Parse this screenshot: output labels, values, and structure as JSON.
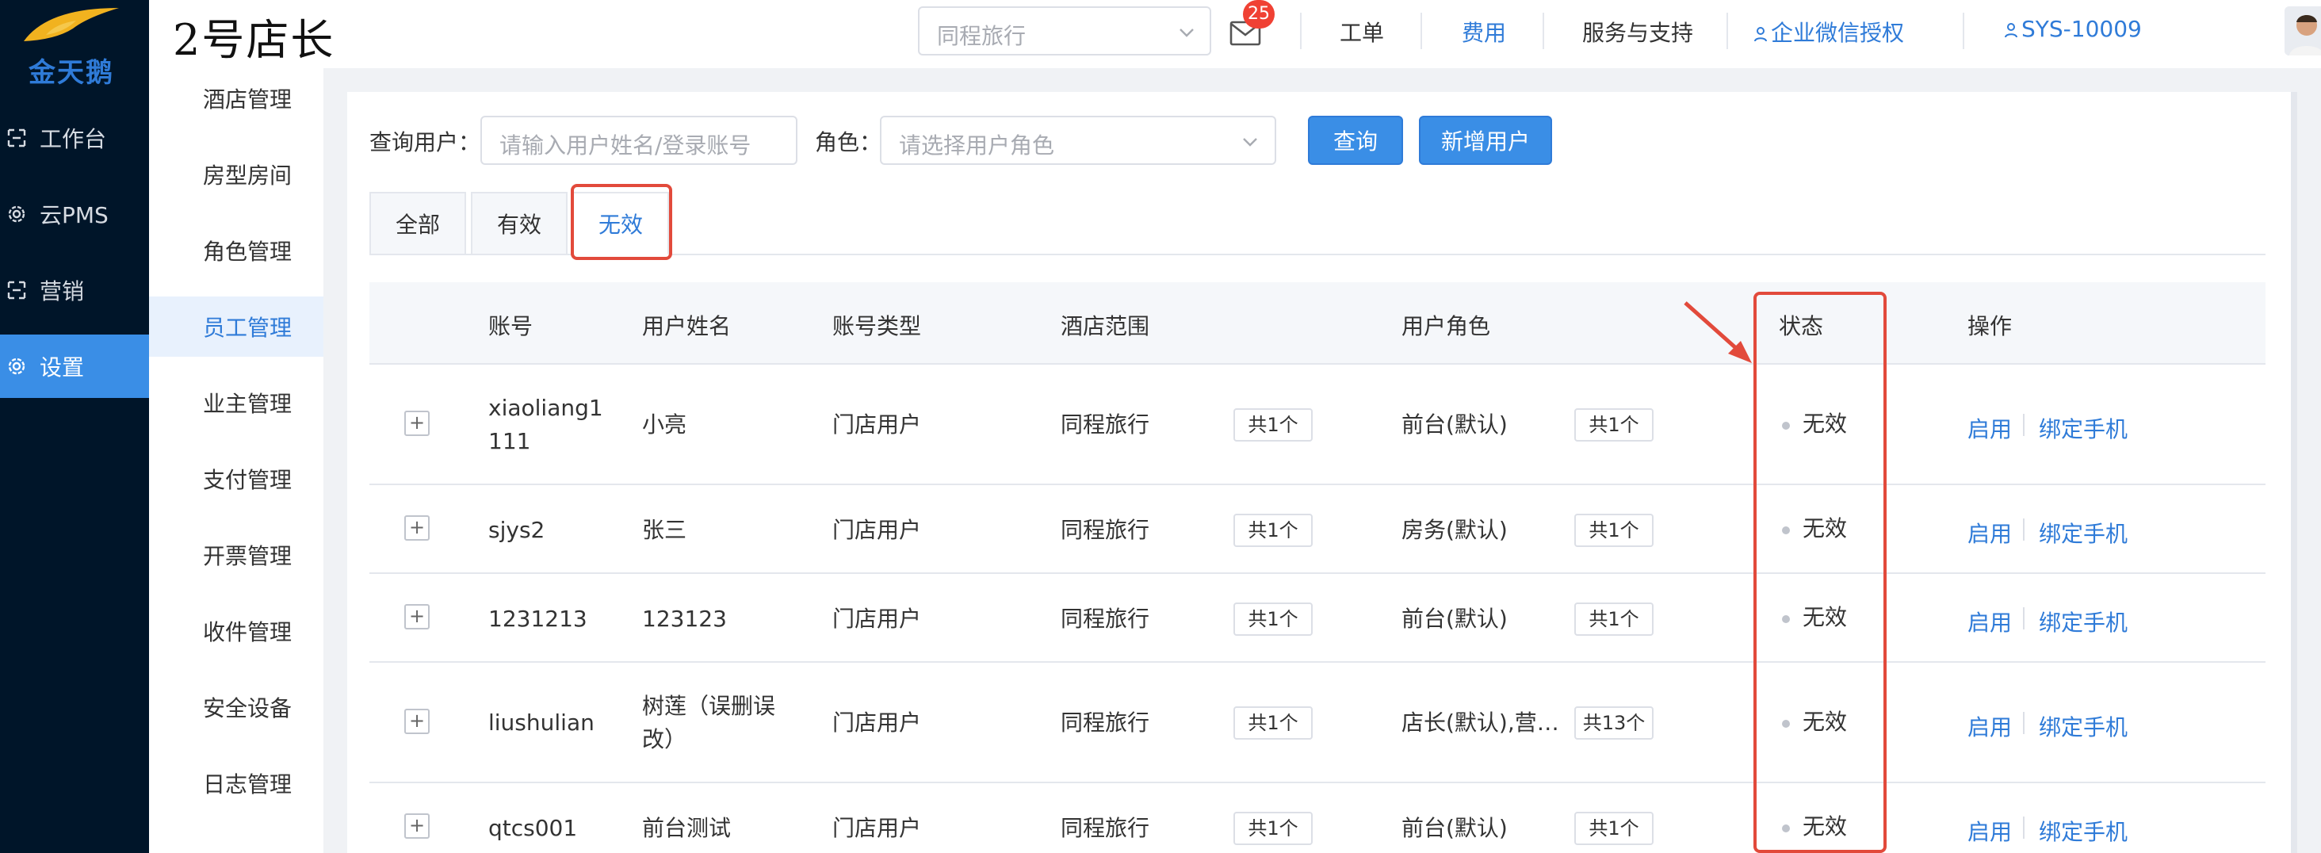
{
  "brand": {
    "logo_text": "金天鹅",
    "app_name": "2号店长"
  },
  "left_nav": {
    "items": [
      {
        "label": "工作台",
        "icon": "workbench-icon"
      },
      {
        "label": "云PMS",
        "icon": "gear-icon"
      },
      {
        "label": "营销",
        "icon": "marketing-icon"
      },
      {
        "label": "设置",
        "icon": "gear-icon",
        "active": true
      }
    ]
  },
  "topbar": {
    "hotel_select": "同程旅行",
    "mail_badge": "25",
    "links": {
      "tickets": "工单",
      "fees": "费用",
      "support": "服务与支持",
      "wechat": "企业微信授权",
      "user": "SYS-10009"
    }
  },
  "sub_menu": {
    "items": [
      "酒店管理",
      "房型房间",
      "角色管理",
      "员工管理",
      "业主管理",
      "支付管理",
      "开票管理",
      "收件管理",
      "安全设备",
      "日志管理"
    ],
    "active": "员工管理"
  },
  "filters": {
    "user_label": "查询用户：",
    "user_placeholder": "请输入用户姓名/登录账号",
    "role_label": "角色：",
    "role_placeholder": "请选择用户角色",
    "query_button": "查询",
    "add_button": "新增用户"
  },
  "tabs": [
    "全部",
    "有效",
    "无效"
  ],
  "active_tab": "无效",
  "table": {
    "headers": {
      "account": "账号",
      "name": "用户姓名",
      "type": "账号类型",
      "scope": "酒店范围",
      "role": "用户角色",
      "status": "状态",
      "actions": "操作"
    },
    "rows": [
      {
        "account": [
          "xiaoliang1",
          "111"
        ],
        "name": [
          "小亮"
        ],
        "type": "门店用户",
        "scope": "同程旅行",
        "scope_count": "共1个",
        "role": "前台(默认)",
        "role_count": "共1个",
        "status": "无效",
        "action_enable": "启用",
        "action_bind": "绑定手机"
      },
      {
        "account": [
          "sjys2"
        ],
        "name": [
          "张三"
        ],
        "type": "门店用户",
        "scope": "同程旅行",
        "scope_count": "共1个",
        "role": "房务(默认)",
        "role_count": "共1个",
        "status": "无效",
        "action_enable": "启用",
        "action_bind": "绑定手机"
      },
      {
        "account": [
          "1231213"
        ],
        "name": [
          "123123"
        ],
        "type": "门店用户",
        "scope": "同程旅行",
        "scope_count": "共1个",
        "role": "前台(默认)",
        "role_count": "共1个",
        "status": "无效",
        "action_enable": "启用",
        "action_bind": "绑定手机"
      },
      {
        "account": [
          "liushulian"
        ],
        "name": [
          "树莲（误删误",
          "改）"
        ],
        "type": "门店用户",
        "scope": "同程旅行",
        "scope_count": "共1个",
        "role": "店长(默认),营…",
        "role_count": "共13个",
        "status": "无效",
        "action_enable": "启用",
        "action_bind": "绑定手机"
      },
      {
        "account": [
          "qtcs001"
        ],
        "name": [
          "前台测试"
        ],
        "type": "门店用户",
        "scope": "同程旅行",
        "scope_count": "共1个",
        "role": "前台(默认)",
        "role_count": "共1个",
        "status": "无效",
        "action_enable": "启用",
        "action_bind": "绑定手机"
      }
    ]
  },
  "colors": {
    "primary": "#3a8ee6",
    "nav_bg": "#001529",
    "annotation": "#e24a3b"
  }
}
